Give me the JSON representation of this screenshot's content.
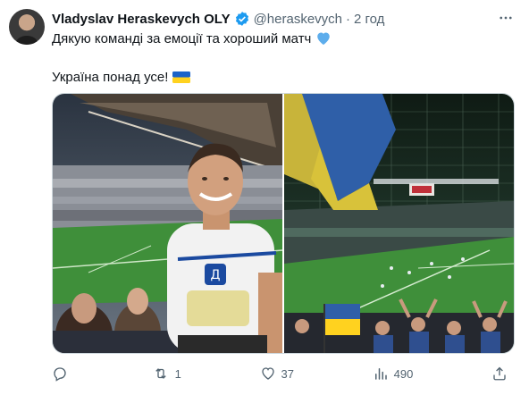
{
  "tweet": {
    "author_name": "Vladyslav Heraskevych OLY",
    "handle": "@heraskevych",
    "separator": "·",
    "time": "2 год",
    "line1": "Дякую команді за емоції та хороший матч",
    "line1_emoji": "blue-heart",
    "line2": "Україна понад усе!",
    "line2_emoji": "ukraine-flag"
  },
  "media": [
    {
      "name": "selfie-photo",
      "description_icon": "stadium-selfie"
    },
    {
      "name": "stadium-photo",
      "description_icon": "stadium-flag"
    }
  ],
  "actions": {
    "reply_count": "",
    "retweet_count": "1",
    "like_count": "37",
    "views_count": "490",
    "share_count": ""
  },
  "colors": {
    "text": "#0f1419",
    "secondary": "#536471",
    "verified": "#1d9bf0",
    "pitch": "#3f8f3a"
  }
}
